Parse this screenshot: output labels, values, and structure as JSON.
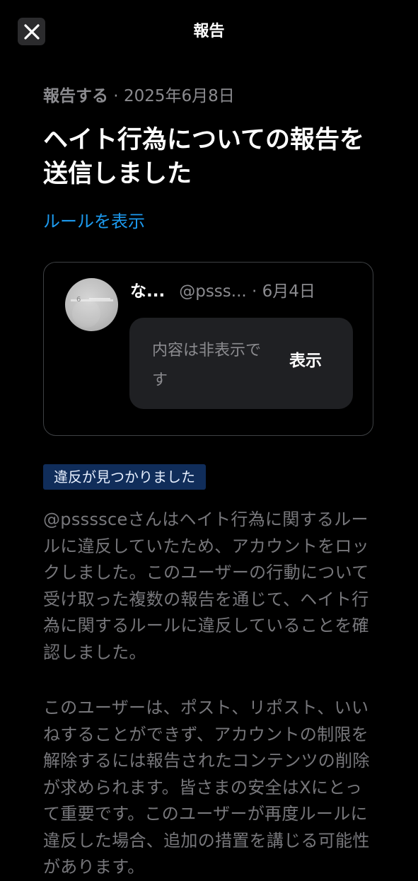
{
  "header": {
    "title": "報告",
    "close_icon": "close-icon"
  },
  "report": {
    "meta_action": "報告する",
    "meta_separator": " · ",
    "meta_date": "2025年6月8日",
    "title": "ヘイト行為についての報告を送信しました",
    "rules_link": "ルールを表示"
  },
  "post": {
    "author_name": "な...",
    "handle": "@psss...",
    "date": " · 6月4日",
    "hidden_notice": "内容は非表示です",
    "show_label": "表示"
  },
  "violation": {
    "badge": "違反が見つかりました",
    "paragraph1": "@pssssceさんはヘイト行為に関するルールに違反していたため、アカウントをロックしました。このユーザーの行動について受け取った複数の報告を通じて、ヘイト行為に関するルールに違反していることを確認しました。",
    "paragraph2": "このユーザーは、ポスト、リポスト、いいねすることができず、アカウントの制限を解除するには報告されたコンテンツの削除が求められます。皆さまの安全はXにとって重要です。このユーザーが再度ルールに違反した場合、追加の措置を講じる可能性があります。"
  },
  "colors": {
    "background": "#000000",
    "link": "#1d9bf0",
    "badge_bg": "#102d5a",
    "muted_text": "#8b8b8f"
  }
}
